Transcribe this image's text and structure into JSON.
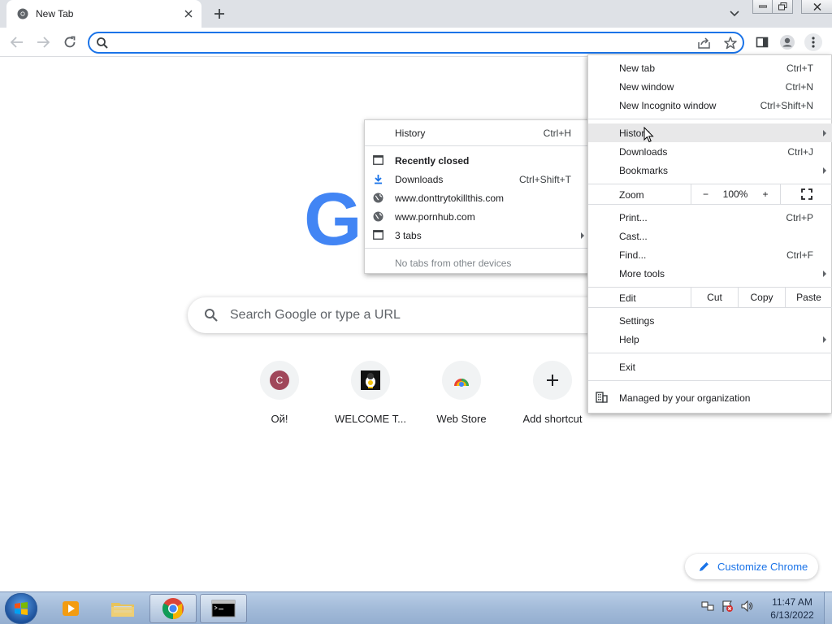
{
  "browser": {
    "tab": {
      "title": "New Tab"
    },
    "omnibox": {
      "value": "",
      "placeholder": ""
    }
  },
  "ntp": {
    "logo_letter": "G",
    "search_placeholder": "Search Google or type a URL",
    "shortcuts": [
      {
        "label": "Ой!",
        "letter": "C"
      },
      {
        "label": "WELCOME T..."
      },
      {
        "label": "Web Store"
      },
      {
        "label": "Add shortcut"
      }
    ],
    "customize_label": "Customize Chrome"
  },
  "menu": {
    "new_tab": "New tab",
    "new_tab_sc": "Ctrl+T",
    "new_window": "New window",
    "new_window_sc": "Ctrl+N",
    "new_incognito": "New Incognito window",
    "new_incognito_sc": "Ctrl+Shift+N",
    "history": "History",
    "downloads": "Downloads",
    "downloads_sc": "Ctrl+J",
    "bookmarks": "Bookmarks",
    "zoom": "Zoom",
    "zoom_minus": "−",
    "zoom_value": "100%",
    "zoom_plus": "+",
    "print": "Print...",
    "print_sc": "Ctrl+P",
    "cast": "Cast...",
    "find": "Find...",
    "find_sc": "Ctrl+F",
    "more_tools": "More tools",
    "edit": "Edit",
    "cut": "Cut",
    "copy": "Copy",
    "paste": "Paste",
    "settings": "Settings",
    "help": "Help",
    "exit": "Exit",
    "managed": "Managed by your organization"
  },
  "history_submenu": {
    "history": "History",
    "history_sc": "Ctrl+H",
    "recently_closed": "Recently closed",
    "downloads": "Downloads",
    "downloads_sc": "Ctrl+Shift+T",
    "site1": "www.donttrytokillthis.com",
    "site2": "www.pornhub.com",
    "tabs": "3 tabs",
    "no_tabs": "No tabs from other devices"
  },
  "taskbar": {
    "time": "11:47 AM",
    "date": "6/13/2022"
  },
  "colors": {
    "accent": "#1a73e8",
    "menu_hover": "#e8e8e9",
    "google_blue": "#4285f4"
  },
  "icons": [
    "chrome-favicon",
    "close-icon",
    "plus-icon",
    "chevron-down-icon",
    "back-icon",
    "forward-icon",
    "reload-icon",
    "search-icon",
    "share-icon",
    "star-icon",
    "sidepanel-icon",
    "profile-icon",
    "kebab-icon",
    "pencil-icon",
    "globe-icon",
    "download-icon",
    "window-icon",
    "building-icon",
    "fullscreen-icon"
  ]
}
